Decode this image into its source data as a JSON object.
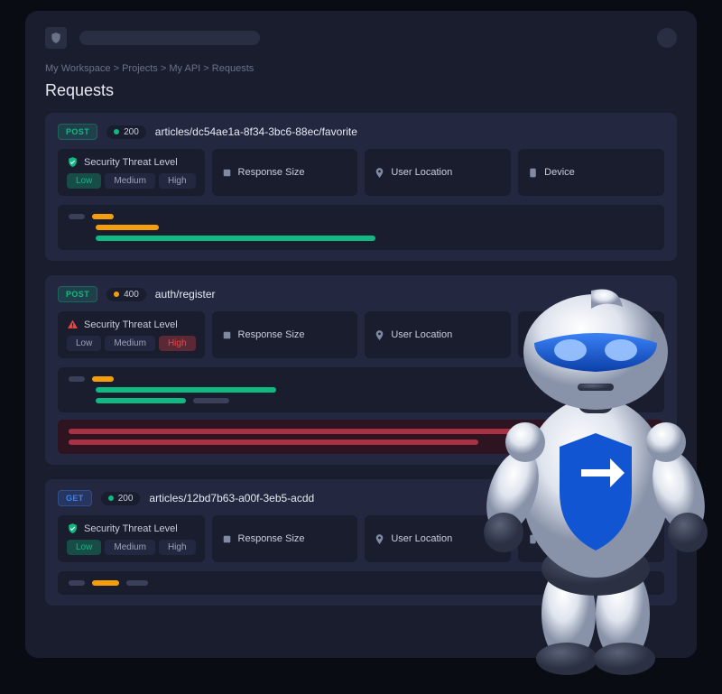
{
  "breadcrumb": [
    "My Workspace",
    "Projects",
    "My API",
    "Requests"
  ],
  "page_title": "Requests",
  "threat_label": "Security Threat Level",
  "levels": {
    "low": "Low",
    "medium": "Medium",
    "high": "High"
  },
  "metrics": {
    "response_size": "Response Size",
    "user_location": "User Location",
    "device": "Device"
  },
  "requests": [
    {
      "method": "POST",
      "status_code": "200",
      "status_color": "green",
      "path": "articles/dc54ae1a-8f34-3bc6-88ec/favorite",
      "threat_active": "low",
      "threat_icon": "shield-check"
    },
    {
      "method": "POST",
      "status_code": "400",
      "status_color": "amber",
      "path": "auth/register",
      "threat_active": "high",
      "threat_icon": "alert-triangle"
    },
    {
      "method": "GET",
      "status_code": "200",
      "status_color": "green",
      "path": "articles/12bd7b63-a00f-3eb5-acdd",
      "threat_active": "low",
      "threat_icon": "shield-check"
    }
  ],
  "colors": {
    "green": "#10b981",
    "amber": "#f59e0b",
    "red": "#ef4444",
    "blue": "#3b82f6",
    "muted": "#3a3f5a"
  }
}
